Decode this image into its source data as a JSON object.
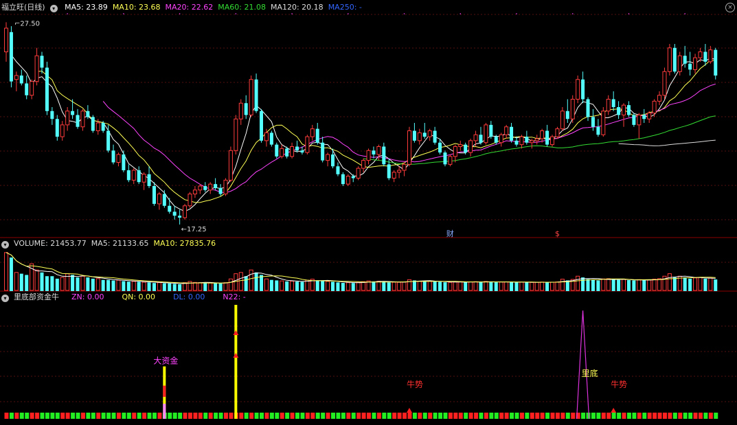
{
  "main_panel": {
    "title": "福立旺(日线)",
    "ma": [
      {
        "label": "MA5: 23.89",
        "color": "#ffffff"
      },
      {
        "label": "MA10: 23.68",
        "color": "#ffff55"
      },
      {
        "label": "MA20: 22.62",
        "color": "#ff44ff"
      },
      {
        "label": "MA60: 21.08",
        "color": "#33dd33"
      },
      {
        "label": "MA120: 20.18",
        "color": "#dddddd"
      },
      {
        "label": "MA250: -",
        "color": "#3366ff"
      }
    ],
    "high_label": "27.50",
    "low_label": "17.25",
    "markers": [
      {
        "text": "财",
        "color": "#88aaff"
      },
      {
        "text": "$",
        "color": "#ff4444"
      }
    ]
  },
  "volume_panel": {
    "labels": [
      {
        "text": "VOLUME: 21453.77",
        "color": "#dddddd"
      },
      {
        "text": "MA5: 21133.65",
        "color": "#dddddd"
      },
      {
        "text": "MA10: 27835.76",
        "color": "#ffff55"
      }
    ]
  },
  "indicator_panel": {
    "title": "里底部资金牛",
    "labels": [
      {
        "text": "ZN: 0.00",
        "color": "#ff44ff"
      },
      {
        "text": "QN: 0.00",
        "color": "#ffff55"
      },
      {
        "text": "DL: 0.00",
        "color": "#3366ff"
      },
      {
        "text": "N22: -",
        "color": "#ff44ff"
      }
    ],
    "annotations": {
      "big_capital": "大资金",
      "bottom": "里底",
      "bull1": "牛势",
      "bull2": "牛势"
    }
  },
  "chart_data": {
    "type": "candlestick",
    "price_range": [
      16.8,
      28.0
    ],
    "high": 27.5,
    "low": 17.25,
    "candles": [
      [
        26.0,
        27.5,
        25.5,
        27.2
      ],
      [
        27.0,
        27.3,
        24.2,
        24.5
      ],
      [
        24.6,
        25.0,
        24.0,
        24.8
      ],
      [
        24.8,
        25.1,
        24.3,
        24.4
      ],
      [
        24.4,
        24.8,
        23.6,
        23.8
      ],
      [
        23.8,
        24.6,
        23.6,
        24.5
      ],
      [
        24.5,
        26.2,
        24.3,
        25.8
      ],
      [
        25.8,
        26.0,
        24.9,
        25.2
      ],
      [
        25.2,
        25.5,
        22.8,
        23.0
      ],
      [
        23.0,
        23.2,
        22.3,
        22.6
      ],
      [
        22.6,
        22.8,
        21.5,
        21.7
      ],
      [
        21.7,
        22.5,
        21.5,
        22.3
      ],
      [
        22.3,
        23.2,
        22.0,
        23.0
      ],
      [
        23.0,
        23.6,
        22.6,
        22.8
      ],
      [
        22.8,
        23.1,
        22.1,
        22.2
      ],
      [
        22.2,
        23.1,
        22.0,
        23.0
      ],
      [
        23.0,
        23.3,
        22.6,
        22.7
      ],
      [
        22.7,
        22.8,
        21.9,
        22.0
      ],
      [
        22.0,
        22.6,
        21.8,
        22.4
      ],
      [
        22.4,
        22.5,
        21.9,
        22.0
      ],
      [
        22.0,
        22.3,
        20.9,
        21.0
      ],
      [
        21.0,
        21.3,
        20.3,
        20.4
      ],
      [
        20.4,
        20.9,
        20.2,
        20.8
      ],
      [
        20.8,
        21.0,
        19.9,
        20.0
      ],
      [
        20.0,
        20.3,
        19.4,
        19.5
      ],
      [
        19.5,
        20.1,
        19.3,
        20.0
      ],
      [
        20.0,
        20.2,
        19.3,
        19.4
      ],
      [
        19.4,
        19.9,
        19.0,
        19.8
      ],
      [
        19.8,
        20.2,
        19.1,
        19.2
      ],
      [
        19.2,
        19.4,
        18.2,
        18.3
      ],
      [
        18.3,
        18.9,
        18.0,
        18.8
      ],
      [
        18.8,
        19.0,
        18.1,
        18.2
      ],
      [
        18.2,
        18.6,
        17.8,
        17.9
      ],
      [
        17.9,
        18.2,
        17.5,
        17.7
      ],
      [
        17.7,
        18.0,
        17.25,
        17.6
      ],
      [
        17.6,
        18.3,
        17.5,
        18.2
      ],
      [
        18.2,
        18.9,
        18.1,
        18.8
      ],
      [
        18.8,
        19.2,
        18.6,
        19.0
      ],
      [
        19.0,
        19.3,
        18.8,
        19.2
      ],
      [
        19.2,
        19.4,
        18.9,
        19.0
      ],
      [
        19.0,
        19.4,
        18.8,
        19.3
      ],
      [
        19.3,
        19.6,
        19.0,
        19.1
      ],
      [
        19.1,
        19.3,
        18.7,
        18.8
      ],
      [
        18.8,
        19.6,
        18.7,
        19.5
      ],
      [
        19.5,
        21.2,
        19.4,
        21.0
      ],
      [
        21.0,
        22.8,
        20.8,
        22.6
      ],
      [
        22.6,
        23.6,
        22.3,
        23.4
      ],
      [
        23.4,
        23.8,
        22.6,
        22.8
      ],
      [
        22.8,
        24.8,
        22.7,
        24.6
      ],
      [
        24.6,
        24.9,
        22.9,
        23.0
      ],
      [
        23.0,
        23.1,
        21.4,
        21.5
      ],
      [
        21.5,
        22.1,
        21.2,
        21.9
      ],
      [
        21.9,
        22.0,
        21.2,
        21.3
      ],
      [
        21.3,
        21.4,
        20.6,
        20.7
      ],
      [
        20.7,
        21.3,
        20.6,
        21.1
      ],
      [
        21.1,
        21.2,
        20.6,
        20.7
      ],
      [
        20.7,
        21.4,
        20.6,
        21.2
      ],
      [
        21.2,
        21.5,
        20.9,
        21.0
      ],
      [
        21.0,
        21.2,
        20.8,
        20.9
      ],
      [
        20.9,
        21.8,
        20.8,
        21.7
      ],
      [
        21.7,
        22.3,
        21.5,
        22.1
      ],
      [
        22.1,
        22.4,
        21.3,
        21.4
      ],
      [
        21.4,
        21.7,
        20.4,
        20.5
      ],
      [
        20.5,
        20.9,
        20.2,
        20.8
      ],
      [
        20.8,
        21.1,
        20.1,
        20.2
      ],
      [
        20.2,
        20.4,
        19.7,
        19.8
      ],
      [
        19.8,
        19.9,
        19.2,
        19.3
      ],
      [
        19.3,
        19.8,
        19.2,
        19.7
      ],
      [
        19.7,
        19.8,
        19.4,
        19.6
      ],
      [
        19.6,
        20.2,
        19.5,
        20.1
      ],
      [
        20.1,
        20.6,
        19.9,
        20.5
      ],
      [
        20.5,
        21.1,
        20.3,
        21.0
      ],
      [
        21.0,
        21.2,
        20.6,
        20.8
      ],
      [
        20.8,
        21.3,
        20.5,
        21.2
      ],
      [
        21.2,
        21.4,
        20.2,
        20.3
      ],
      [
        20.3,
        20.6,
        19.5,
        19.6
      ],
      [
        19.6,
        20.0,
        19.4,
        19.9
      ],
      [
        19.9,
        20.2,
        19.6,
        20.0
      ],
      [
        20.0,
        20.4,
        19.7,
        20.3
      ],
      [
        20.3,
        22.2,
        20.2,
        22.0
      ],
      [
        22.0,
        22.4,
        21.4,
        21.5
      ],
      [
        21.5,
        22.1,
        21.3,
        21.9
      ],
      [
        21.9,
        22.4,
        21.6,
        21.7
      ],
      [
        21.7,
        22.1,
        21.5,
        22.0
      ],
      [
        22.0,
        22.2,
        21.3,
        21.4
      ],
      [
        21.4,
        21.6,
        20.8,
        20.9
      ],
      [
        20.9,
        21.0,
        20.2,
        20.3
      ],
      [
        20.3,
        20.8,
        20.2,
        20.7
      ],
      [
        20.7,
        21.3,
        20.4,
        21.2
      ],
      [
        21.2,
        21.5,
        21.0,
        21.3
      ],
      [
        21.3,
        21.4,
        20.8,
        20.9
      ],
      [
        20.9,
        21.6,
        20.7,
        21.5
      ],
      [
        21.5,
        22.0,
        21.2,
        21.8
      ],
      [
        21.8,
        22.2,
        21.3,
        21.4
      ],
      [
        21.4,
        22.4,
        21.3,
        22.3
      ],
      [
        22.3,
        22.5,
        21.6,
        21.7
      ],
      [
        21.7,
        21.8,
        21.3,
        21.4
      ],
      [
        21.4,
        21.9,
        21.2,
        21.8
      ],
      [
        21.8,
        22.3,
        21.6,
        22.2
      ],
      [
        22.2,
        22.4,
        21.4,
        21.5
      ],
      [
        21.5,
        21.7,
        21.2,
        21.3
      ],
      [
        21.3,
        21.8,
        21.1,
        21.7
      ],
      [
        21.7,
        22.0,
        21.3,
        21.4
      ],
      [
        21.4,
        21.6,
        21.1,
        21.5
      ],
      [
        21.5,
        21.8,
        21.3,
        21.6
      ],
      [
        21.6,
        22.1,
        21.4,
        22.0
      ],
      [
        22.0,
        22.3,
        21.2,
        21.3
      ],
      [
        21.3,
        21.8,
        21.2,
        21.7
      ],
      [
        21.7,
        22.2,
        21.6,
        22.1
      ],
      [
        22.1,
        23.2,
        22.0,
        23.0
      ],
      [
        23.0,
        23.6,
        22.4,
        22.6
      ],
      [
        22.6,
        23.8,
        22.4,
        23.6
      ],
      [
        23.6,
        24.8,
        23.4,
        24.6
      ],
      [
        24.6,
        25.0,
        23.4,
        23.6
      ],
      [
        23.6,
        23.7,
        22.5,
        22.7
      ],
      [
        22.7,
        23.1,
        22.0,
        22.2
      ],
      [
        22.2,
        22.6,
        21.7,
        21.8
      ],
      [
        21.8,
        23.2,
        21.7,
        23.0
      ],
      [
        23.0,
        23.8,
        22.8,
        23.6
      ],
      [
        23.6,
        24.0,
        23.0,
        23.2
      ],
      [
        23.2,
        23.5,
        22.6,
        22.8
      ],
      [
        22.8,
        23.4,
        22.2,
        23.3
      ],
      [
        23.3,
        23.5,
        22.7,
        22.8
      ],
      [
        22.8,
        22.9,
        22.2,
        22.3
      ],
      [
        22.3,
        22.9,
        21.6,
        22.8
      ],
      [
        22.8,
        23.1,
        22.4,
        22.6
      ],
      [
        22.6,
        23.0,
        22.4,
        22.9
      ],
      [
        22.9,
        23.6,
        22.7,
        23.5
      ],
      [
        23.5,
        24.0,
        23.3,
        23.8
      ],
      [
        23.8,
        25.2,
        23.6,
        25.0
      ],
      [
        25.0,
        26.4,
        24.8,
        26.2
      ],
      [
        26.2,
        26.4,
        24.9,
        25.0
      ],
      [
        25.0,
        26.0,
        24.8,
        25.8
      ],
      [
        25.8,
        26.3,
        25.2,
        25.4
      ],
      [
        25.4,
        26.0,
        24.8,
        25.1
      ],
      [
        25.1,
        25.9,
        24.9,
        25.7
      ],
      [
        25.7,
        26.2,
        25.5,
        26.0
      ],
      [
        26.0,
        26.4,
        25.3,
        25.5
      ],
      [
        25.5,
        26.3,
        25.4,
        26.1
      ],
      [
        26.1,
        26.2,
        24.6,
        24.8
      ]
    ],
    "volume": [
      31000,
      27000,
      15000,
      14000,
      13000,
      22000,
      17000,
      15000,
      12000,
      12000,
      10000,
      11000,
      14000,
      13000,
      11000,
      12000,
      11000,
      10000,
      10000,
      9000,
      9000,
      8500,
      8800,
      8000,
      7600,
      7800,
      7500,
      7200,
      7000,
      6500,
      6800,
      6300,
      6200,
      5800,
      5500,
      6800,
      7800,
      7000,
      6800,
      6500,
      6600,
      6400,
      6100,
      6800,
      9800,
      14000,
      15000,
      12000,
      17000,
      15000,
      13000,
      9800,
      9000,
      8600,
      8200,
      7800,
      8000,
      7600,
      7400,
      8800,
      9600,
      8600,
      8200,
      7800,
      7500,
      7000,
      6600,
      6800,
      6500,
      7000,
      7600,
      8200,
      7800,
      8000,
      7500,
      7000,
      7200,
      7100,
      7300,
      9200,
      8600,
      8000,
      8200,
      7900,
      7700,
      7400,
      7100,
      7000,
      7300,
      7500,
      7200,
      7400,
      7600,
      7300,
      7800,
      7500,
      7100,
      7300,
      7400,
      7200,
      7000,
      7200,
      7100,
      7000,
      7100,
      7300,
      7100,
      7200,
      7400,
      9600,
      8600,
      9400,
      12000,
      11000,
      9600,
      9000,
      8600,
      9800,
      10000,
      9400,
      9000,
      9400,
      8800,
      8600,
      9200,
      8900,
      9000,
      9600,
      10000,
      12000,
      14000,
      11000,
      12000,
      11000,
      10000,
      10600,
      11000,
      10000,
      10400,
      9400
    ],
    "indicator": {
      "big_capital_bar": {
        "index": 31,
        "value": 0.46
      },
      "yellow_bar": {
        "index": 45,
        "value": 1.0
      },
      "bottom_spike": {
        "index": 113,
        "value": 0.95
      },
      "bull_marks": [
        79,
        119
      ]
    }
  }
}
